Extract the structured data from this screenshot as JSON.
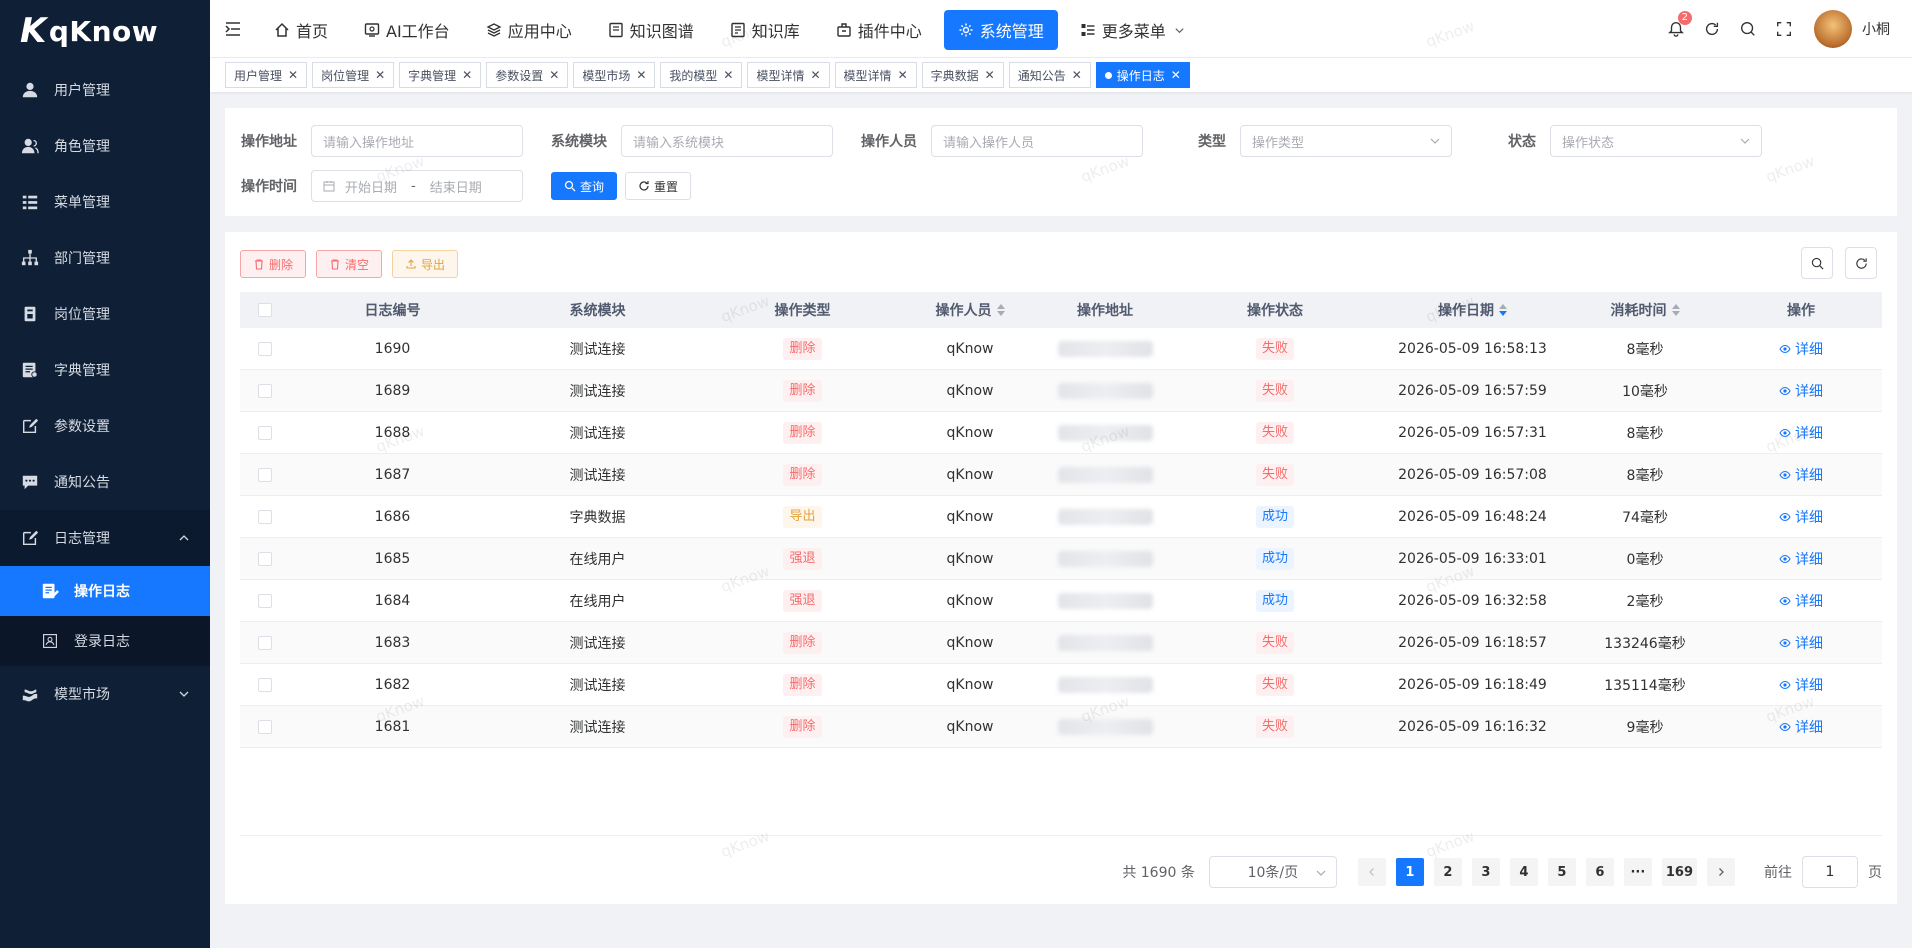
{
  "app": {
    "logo_text": "qKnow"
  },
  "sidebar": {
    "items": [
      {
        "label": "用户管理",
        "icon": "user-icon"
      },
      {
        "label": "角色管理",
        "icon": "role-icon"
      },
      {
        "label": "菜单管理",
        "icon": "menu-tree-icon"
      },
      {
        "label": "部门管理",
        "icon": "org-chart-icon"
      },
      {
        "label": "岗位管理",
        "icon": "post-icon"
      },
      {
        "label": "字典管理",
        "icon": "dict-icon"
      },
      {
        "label": "参数设置",
        "icon": "edit-icon"
      },
      {
        "label": "通知公告",
        "icon": "message-icon"
      },
      {
        "label": "日志管理",
        "icon": "log-icon"
      },
      {
        "label": "模型市场",
        "icon": "model-icon"
      }
    ],
    "sub_items": [
      {
        "label": "操作日志",
        "icon": "oplog-icon"
      },
      {
        "label": "登录日志",
        "icon": "loginlog-icon"
      }
    ]
  },
  "topnav": {
    "items": [
      {
        "label": "首页",
        "icon": "home-icon"
      },
      {
        "label": "AI工作台",
        "icon": "ai-icon"
      },
      {
        "label": "应用中心",
        "icon": "app-icon"
      },
      {
        "label": "知识图谱",
        "icon": "graph-icon"
      },
      {
        "label": "知识库",
        "icon": "kb-icon"
      },
      {
        "label": "插件中心",
        "icon": "plugin-icon"
      },
      {
        "label": "系统管理",
        "icon": "gear-icon"
      },
      {
        "label": "更多菜单",
        "icon": "more-icon"
      }
    ],
    "notification_count": "2",
    "username": "小桐"
  },
  "tags": [
    "用户管理",
    "岗位管理",
    "字典管理",
    "参数设置",
    "模型市场",
    "我的模型",
    "模型详情",
    "模型详情",
    "字典数据",
    "通知公告",
    "操作日志"
  ],
  "search": {
    "op_address_label": "操作地址",
    "op_address_placeholder": "请输入操作地址",
    "module_label": "系统模块",
    "module_placeholder": "请输入系统模块",
    "operator_label": "操作人员",
    "operator_placeholder": "请输入操作人员",
    "type_label": "类型",
    "type_placeholder": "操作类型",
    "status_label": "状态",
    "status_placeholder": "操作状态",
    "time_label": "操作时间",
    "start_placeholder": "开始日期",
    "range_sep": "-",
    "end_placeholder": "结束日期",
    "query_label": "查询",
    "reset_label": "重置"
  },
  "toolbar": {
    "delete_label": "删除",
    "clear_label": "清空",
    "export_label": "导出"
  },
  "table": {
    "headers": [
      "日志编号",
      "系统模块",
      "操作类型",
      "操作人员",
      "操作地址",
      "操作状态",
      "操作日期",
      "消耗时间",
      "操作"
    ],
    "detail_label": "详细",
    "rows": [
      {
        "id": "1690",
        "module": "测试连接",
        "type": "删除",
        "type_color": "red",
        "operator": "qKnow",
        "status": "失败",
        "status_color": "red",
        "date": "2026-05-09 16:58:13",
        "cost": "8毫秒"
      },
      {
        "id": "1689",
        "module": "测试连接",
        "type": "删除",
        "type_color": "red",
        "operator": "qKnow",
        "status": "失败",
        "status_color": "red",
        "date": "2026-05-09 16:57:59",
        "cost": "10毫秒"
      },
      {
        "id": "1688",
        "module": "测试连接",
        "type": "删除",
        "type_color": "red",
        "operator": "qKnow",
        "status": "失败",
        "status_color": "red",
        "date": "2026-05-09 16:57:31",
        "cost": "8毫秒"
      },
      {
        "id": "1687",
        "module": "测试连接",
        "type": "删除",
        "type_color": "red",
        "operator": "qKnow",
        "status": "失败",
        "status_color": "red",
        "date": "2026-05-09 16:57:08",
        "cost": "8毫秒"
      },
      {
        "id": "1686",
        "module": "字典数据",
        "type": "导出",
        "type_color": "orange",
        "operator": "qKnow",
        "status": "成功",
        "status_color": "blue",
        "date": "2026-05-09 16:48:24",
        "cost": "74毫秒"
      },
      {
        "id": "1685",
        "module": "在线用户",
        "type": "强退",
        "type_color": "red",
        "operator": "qKnow",
        "status": "成功",
        "status_color": "blue",
        "date": "2026-05-09 16:33:01",
        "cost": "0毫秒"
      },
      {
        "id": "1684",
        "module": "在线用户",
        "type": "强退",
        "type_color": "red",
        "operator": "qKnow",
        "status": "成功",
        "status_color": "blue",
        "date": "2026-05-09 16:32:58",
        "cost": "2毫秒"
      },
      {
        "id": "1683",
        "module": "测试连接",
        "type": "删除",
        "type_color": "red",
        "operator": "qKnow",
        "status": "失败",
        "status_color": "red",
        "date": "2026-05-09 16:18:57",
        "cost": "133246毫秒"
      },
      {
        "id": "1682",
        "module": "测试连接",
        "type": "删除",
        "type_color": "red",
        "operator": "qKnow",
        "status": "失败",
        "status_color": "red",
        "date": "2026-05-09 16:18:49",
        "cost": "135114毫秒"
      },
      {
        "id": "1681",
        "module": "测试连接",
        "type": "删除",
        "type_color": "red",
        "operator": "qKnow",
        "status": "失败",
        "status_color": "red",
        "date": "2026-05-09 16:16:32",
        "cost": "9毫秒"
      }
    ]
  },
  "pagination": {
    "total_text": "共 1690 条",
    "page_size": "10条/页",
    "pages": [
      "1",
      "2",
      "3",
      "4",
      "5",
      "6",
      "···",
      "169"
    ],
    "goto_label": "前往",
    "goto_value": "1",
    "page_suffix": "页"
  },
  "watermark": "qKnow",
  "colors": {
    "primary": "#1677ff",
    "sidebar_bg": "#0f1f36",
    "danger": "#f56c6c",
    "warning": "#e6a23c"
  }
}
